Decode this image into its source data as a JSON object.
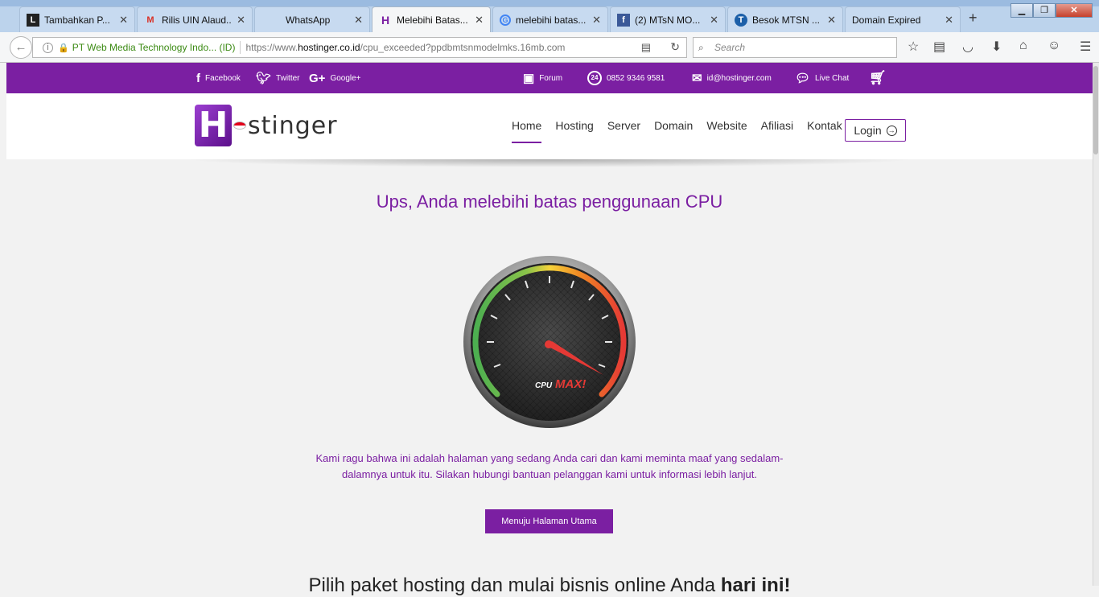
{
  "browser": {
    "tabs": [
      {
        "title": "Tambahkan P...",
        "icon": "lk-logo-icon"
      },
      {
        "title": "Rilis UIN Alaud...",
        "icon": "gmail-icon"
      },
      {
        "title": "WhatsApp",
        "icon": "whatsapp-icon"
      },
      {
        "title": "Melebihi Batas...",
        "icon": "hostinger-icon"
      },
      {
        "title": "melebihi batas...",
        "icon": "google-icon"
      },
      {
        "title": "(2) MTsN MO...",
        "icon": "facebook-icon"
      },
      {
        "title": "Besok MTSN ...",
        "icon": "site-icon"
      },
      {
        "title": "Domain Expired",
        "icon": ""
      }
    ],
    "new_tab": "+",
    "site_identity": "PT Web Media Technology Indo... (ID)",
    "url_prefix": "https://www.",
    "url_domain": "hostinger.co.id",
    "url_path": "/cpu_exceeded?ppdbmtsnmodelmks.16mb.com",
    "search_placeholder": "Search"
  },
  "topbar": {
    "facebook": "Facebook",
    "twitter": "Twitter",
    "google": "Google+",
    "forum": "Forum",
    "phone": "0852 9346 9581",
    "email": "id@hostinger.com",
    "chat": "Live Chat"
  },
  "header": {
    "logo_text": "stinger",
    "menu": [
      "Home",
      "Hosting",
      "Server",
      "Domain",
      "Website",
      "Afiliasi",
      "Kontak"
    ],
    "login": "Login"
  },
  "main": {
    "title": "Ups, Anda melebihi batas penggunaan CPU",
    "gauge_label_cpu": "CPU",
    "gauge_label_max": "MAX!",
    "description": "Kami ragu bahwa ini adalah halaman yang sedang Anda cari dan kami meminta maaf yang sedalam-dalamnya untuk itu. Silakan hubungi bantuan pelanggan kami untuk informasi lebih lanjut.",
    "button": "Menuju Halaman Utama",
    "bottom_title": "Pilih paket hosting dan mulai bisnis online Anda",
    "bottom_title_bold": "hari ini!"
  },
  "colors": {
    "brand": "#7b1fa2"
  }
}
